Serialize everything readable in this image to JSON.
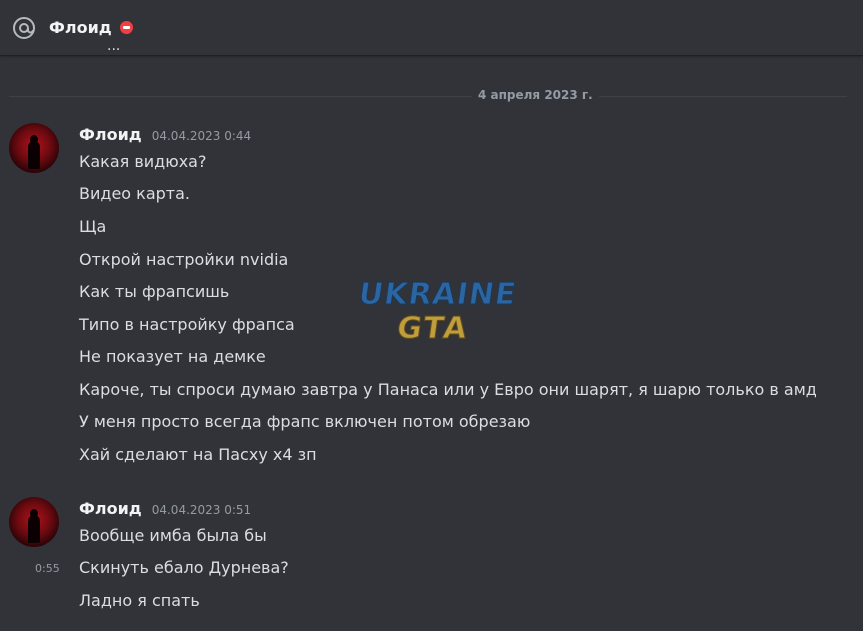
{
  "header": {
    "title": "Флоид",
    "status": "dnd"
  },
  "partial_text": "...",
  "divider": {
    "label": "4 апреля 2023 г."
  },
  "messages": [
    {
      "author": "Флоид",
      "timestamp": "04.04.2023 0:44",
      "lines": [
        "Какая видюха?",
        "Видео карта.",
        "Ща",
        "Открой настройки nvidia",
        "Как ты фрапсишь",
        "Типо в настройку фрапса",
        "Не показует на демке",
        "Кароче, ты спроси думаю завтра у Панаса или у Евро они шарят, я шарю только в амд",
        "У меня просто всегда фрапс включен потом обрезаю",
        "Хай сделают на Пасху х4 зп"
      ]
    },
    {
      "author": "Флоид",
      "timestamp": "04.04.2023 0:51",
      "hover_time": "0:55",
      "lines": [
        "Вообще имба была бы",
        "Скинуть ебало Дурнева?",
        "Ладно я спать"
      ]
    }
  ],
  "watermark": {
    "line1": "UKRAINE",
    "line2": "GTA"
  },
  "colors": {
    "background": "#313338",
    "text": "#dbdee1",
    "muted": "#949ba4",
    "dnd": "#f23f43"
  }
}
